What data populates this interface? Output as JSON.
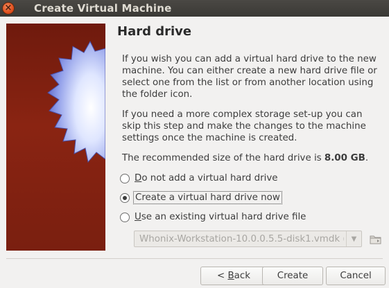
{
  "window": {
    "title": "Create Virtual Machine",
    "close_glyph": "×"
  },
  "page": {
    "heading": "Hard drive",
    "para1": "If you wish you can add a virtual hard drive to the new machine. You can either create a new hard drive file or select one from the list or from another location using the folder icon.",
    "para2": "If you need a more complex storage set-up you can skip this step and make the changes to the machine settings once the machine is created.",
    "recommended_prefix": "The recommended size of the hard drive is ",
    "recommended_size": "8.00 GB",
    "recommended_suffix": "."
  },
  "options": [
    {
      "label_mnemonic": "D",
      "label_rest": "o not add a virtual hard drive",
      "checked": false
    },
    {
      "label_mnemonic": "",
      "label_rest": "Create a virtual hard drive now",
      "checked": true
    },
    {
      "label_mnemonic": "U",
      "label_rest": "se an existing virtual hard drive file",
      "checked": false
    }
  ],
  "existing_file": {
    "selected": "Whonix-Workstation-10.0.0.5.5-disk1.vmdk (N",
    "arrow_glyph": "▼"
  },
  "buttons": {
    "back_prefix": "< ",
    "back_mnemonic": "B",
    "back_rest": "ack",
    "create": "Create",
    "cancel": "Cancel"
  },
  "icons": {
    "side_graphic": "starburst-wizard-graphic",
    "folder": "folder-icon"
  }
}
